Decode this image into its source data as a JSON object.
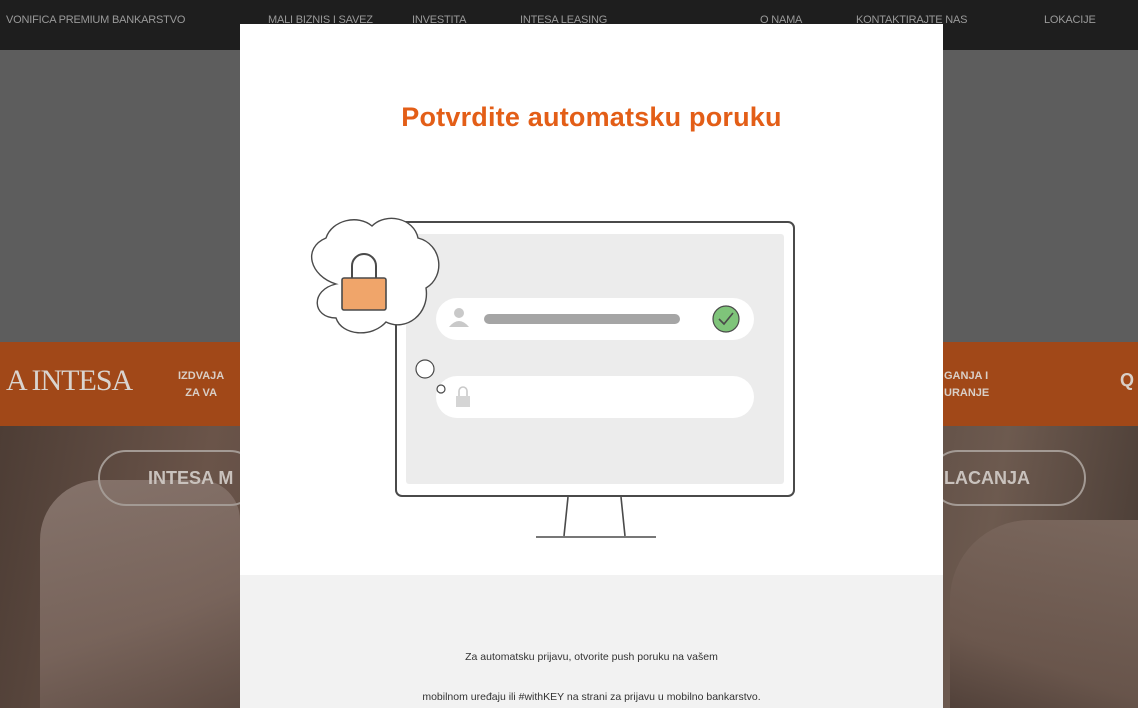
{
  "background_page": {
    "topbar": {
      "items": [
        "VONIFICA PREMIUM BANKARSTVO",
        "MALI BIZNIS I SAVEZ",
        "INVESTITA",
        "INTESA LEASING",
        "O NAMA",
        "KONTAKTIRAJTE NAS",
        "LOKACIJE"
      ]
    },
    "logo": "A INTESA",
    "nav": {
      "left_line1": "IZDVAJA",
      "left_line2": "ZA VA",
      "right_line1": "GANJA I",
      "right_line2": "URANJE",
      "far_right": "Q"
    },
    "pills": {
      "left": "INTESA M",
      "right": "LACANJA"
    }
  },
  "modal": {
    "title": "Potvrdite automatsku poruku",
    "illustration": {
      "icons": [
        "lock-icon",
        "user-icon",
        "checkmark-icon",
        "small-lock-icon"
      ]
    },
    "footer": {
      "line1": "Za automatsku prijavu, otvorite push poruku na vašem",
      "line2": "mobilnom uređaju ili #withKEY na strani za prijavu u mobilno bankarstvo."
    }
  },
  "colors": {
    "accent": "#e35e17",
    "navbar_dimmed": "#a14818",
    "lock_orange": "#f0a56a",
    "check_green": "#7fc47a"
  }
}
